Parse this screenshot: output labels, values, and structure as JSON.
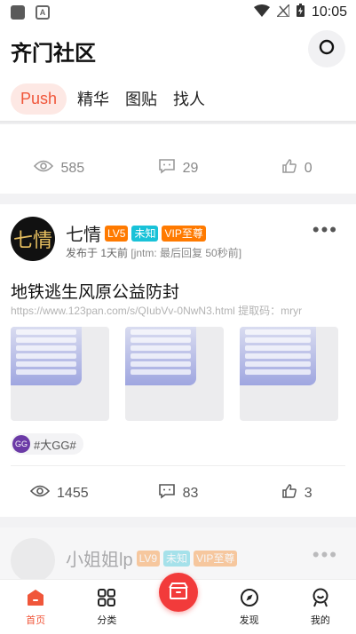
{
  "status_bar": {
    "time": "10:05",
    "notif_icon": "A"
  },
  "header": {
    "title": "齐门社区"
  },
  "tabs": [
    {
      "label": "Push",
      "active": true
    },
    {
      "label": "精华",
      "active": false
    },
    {
      "label": "图贴",
      "active": false
    },
    {
      "label": "找人",
      "active": false
    }
  ],
  "prev_post": {
    "views": "585",
    "comments": "29",
    "likes": "0"
  },
  "post": {
    "avatar_text": "七情",
    "author": "七情",
    "level": "LV5",
    "gender": "未知",
    "vip": "VIP至尊",
    "posted": "发布于 1天前",
    "last_reply": "[jntm: 最后回复 50秒前]",
    "title": "地铁逃生风原公益防封",
    "link": "https://www.123pan.com/s/QIubVv-0NwN3.html  提取码：mryr",
    "tag": "#大GG#",
    "tag_icon": "GG",
    "views": "1455",
    "comments": "83",
    "likes": "3"
  },
  "next_post": {
    "author": "小姐姐lp",
    "level": "LV9",
    "gender": "未知",
    "vip": "VIP至尊"
  },
  "nav": [
    {
      "label": "首页",
      "active": true
    },
    {
      "label": "分类",
      "active": false
    },
    {
      "label": "发现",
      "active": false
    },
    {
      "label": "我的",
      "active": false
    }
  ],
  "colors": {
    "accent": "#f0563a",
    "badge_orange": "#ff7a00",
    "badge_cyan": "#19c2d8",
    "center_button": "#f23b3b"
  }
}
